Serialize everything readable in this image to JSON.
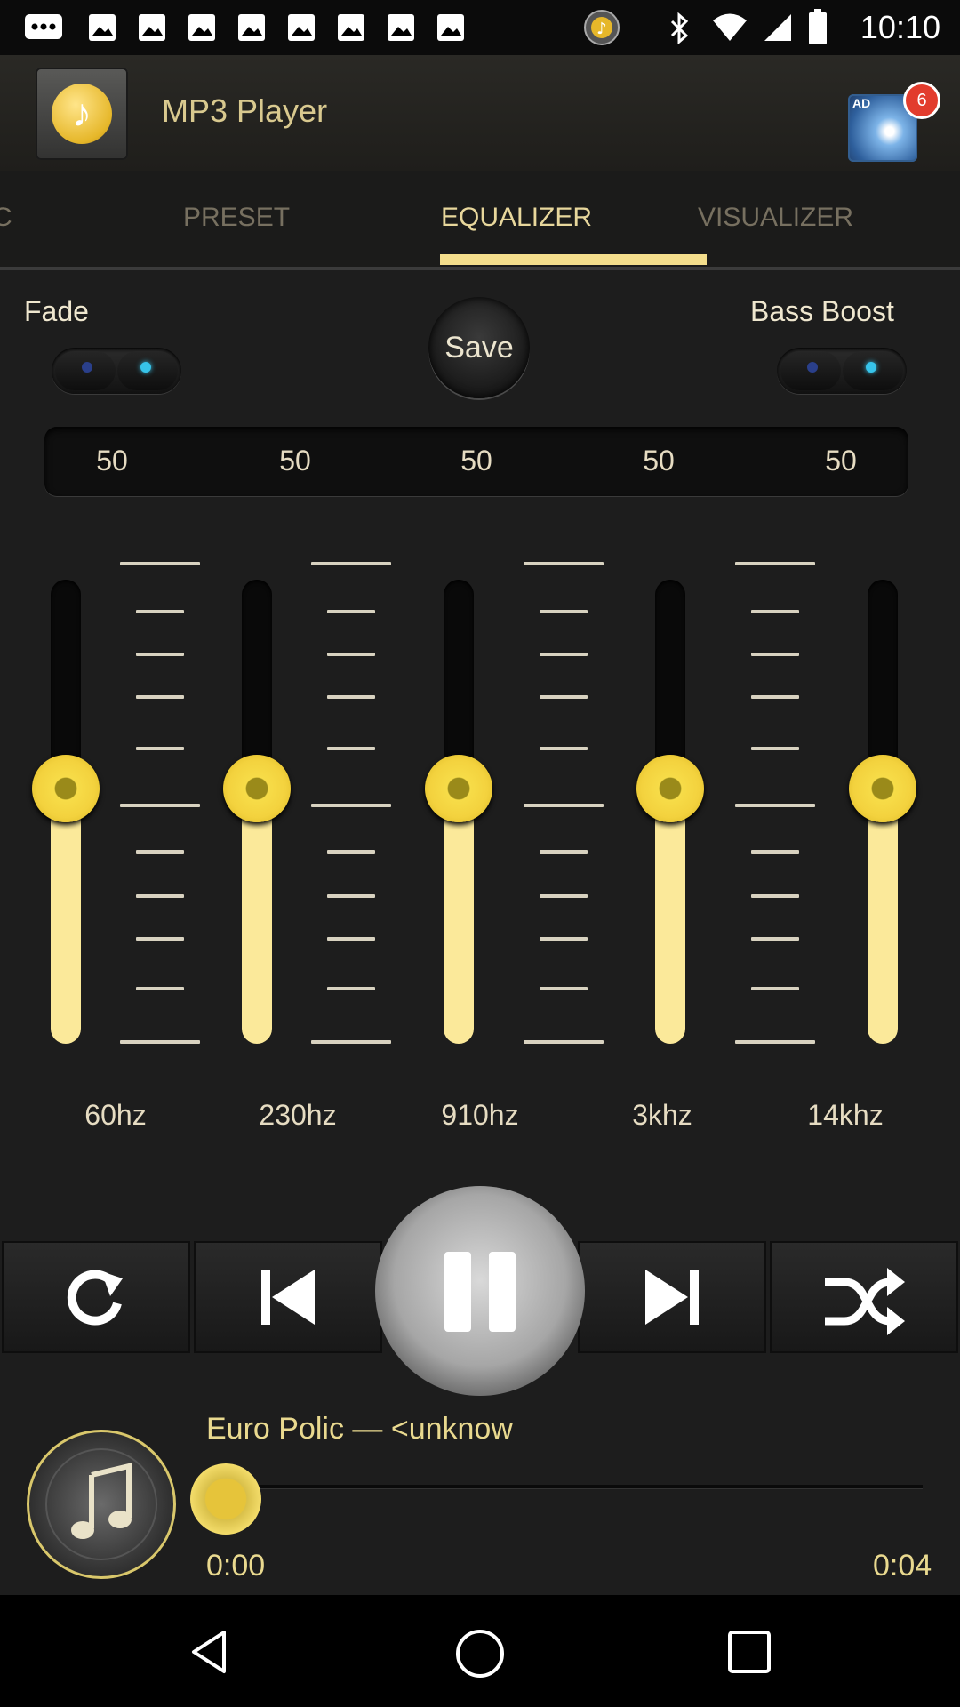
{
  "status_bar": {
    "time": "10:10"
  },
  "header": {
    "title": "MP3 Player",
    "ad_label": "AD",
    "ad_count": "6"
  },
  "tabs": [
    "C",
    "PRESET",
    "EQUALIZER",
    "VISUALIZER"
  ],
  "active_tab": "EQUALIZER",
  "equalizer": {
    "fade_label": "Fade",
    "bass_boost_label": "Bass Boost",
    "save_label": "Save",
    "values": [
      "50",
      "50",
      "50",
      "50",
      "50"
    ],
    "bands": [
      "60hz",
      "230hz",
      "910hz",
      "3khz",
      "14khz"
    ],
    "levels": [
      0.5,
      0.5,
      0.5,
      0.5,
      0.5
    ]
  },
  "now_playing": {
    "title": "Euro Polic — <unknow",
    "elapsed": "0:00",
    "duration": "0:04",
    "progress": 0.0
  },
  "colors": {
    "accent": "#f4de8c",
    "knob": "#f3d23e",
    "background": "#1d1d1d"
  }
}
